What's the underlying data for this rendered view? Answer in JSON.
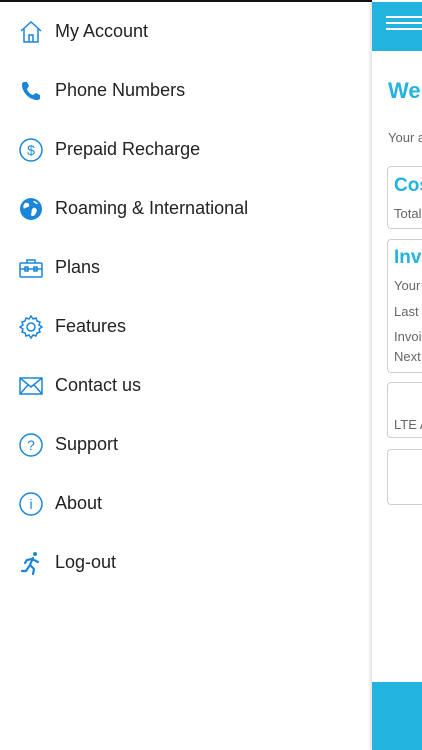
{
  "menu": {
    "items": [
      {
        "label": "My Account",
        "icon": "home-icon"
      },
      {
        "label": "Phone Numbers",
        "icon": "phone-icon"
      },
      {
        "label": "Prepaid Recharge",
        "icon": "dollar-circle-icon"
      },
      {
        "label": "Roaming & International",
        "icon": "globe-icon"
      },
      {
        "label": "Plans",
        "icon": "toolbox-icon"
      },
      {
        "label": "Features",
        "icon": "gear-icon"
      },
      {
        "label": "Contact us",
        "icon": "envelope-icon"
      },
      {
        "label": "Support",
        "icon": "question-circle-icon"
      },
      {
        "label": "About",
        "icon": "info-circle-icon"
      },
      {
        "label": "Log-out",
        "icon": "running-person-icon"
      }
    ]
  },
  "panel": {
    "welcome": "Wel",
    "account_line": "Your a",
    "cost_card": {
      "title": "Cos",
      "line": "Total"
    },
    "invoice_card": {
      "title": "Inv",
      "lines": [
        "Your",
        "Last",
        "Invoic",
        "Next"
      ]
    },
    "lte_card": {
      "line": "LTE A"
    }
  },
  "colors": {
    "accent": "#22b3df",
    "icon_blue": "#1a86d9"
  }
}
